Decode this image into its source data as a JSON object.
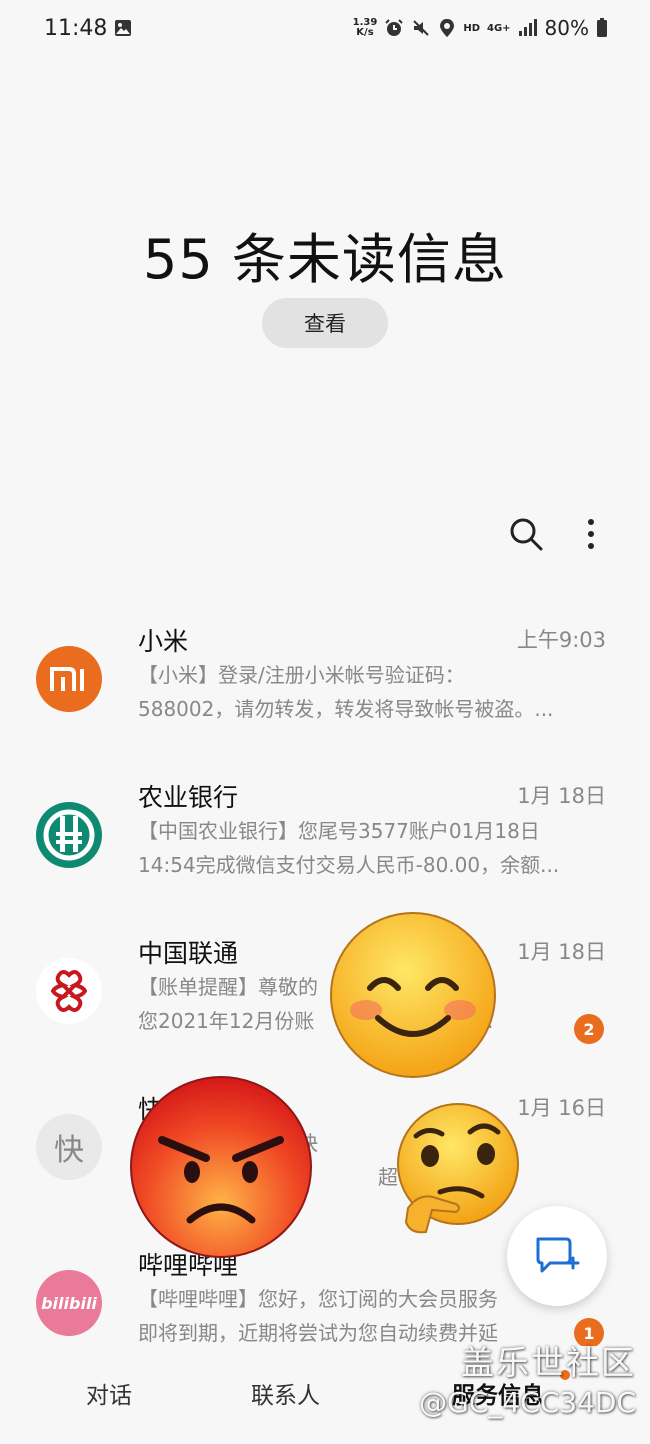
{
  "status_bar": {
    "time": "11:48",
    "net_speed_value": "1.39",
    "net_speed_unit": "K/s",
    "hd": "HD",
    "network": "4G+",
    "battery": "80%"
  },
  "header": {
    "unread_title": "55 条未读信息",
    "view_button": "查看"
  },
  "toolbar": {
    "search_icon": "search-icon",
    "more_icon": "more-vertical-icon"
  },
  "conversations": [
    {
      "name": "小米",
      "time": "上午9:03",
      "preview_line1": "【小米】登录/注册小米帐号验证码：",
      "preview_line2": "588002，请勿转发，转发将导致帐号被盗。...",
      "avatar_text": "mi",
      "avatar_color": "#ea6c1e"
    },
    {
      "name": "农业银行",
      "time": "1月 18日",
      "preview_line1": "【中国农业银行】您尾号3577账户01月18日",
      "preview_line2": "14:54完成微信支付交易人民币-80.00，余额...",
      "avatar_color": "#0f8a72"
    },
    {
      "name": "中国联通",
      "time": "1月 18日",
      "preview_line1": "【账单提醒】尊敬的　　　　　　用户，",
      "preview_line2": "您2021年12月份账　　　　　　中赠...",
      "badge": "2",
      "avatar_color": "#c8171e"
    },
    {
      "name": "快",
      "time": "1月 16日",
      "preview_line1": "　　　　　，中通快",
      "preview_line2": "　　　　已到达　　　　　超市...",
      "avatar_text": "快"
    },
    {
      "name": "哔哩哔哩",
      "time": "",
      "preview_line1": "【哔哩哔哩】您好，您订阅的大会员服务",
      "preview_line2": "即将到期，近期将尝试为您自动续费并延",
      "badge": "1",
      "avatar_text": "bilibili",
      "avatar_color": "#ea7a99"
    }
  ],
  "fab": {
    "icon": "new-message-icon"
  },
  "bottom_nav": {
    "tabs": [
      "对话",
      "联系人",
      "服务信息"
    ]
  },
  "watermark": {
    "line1": "盖乐世社区",
    "line2": "@GC_4CC34DC"
  }
}
